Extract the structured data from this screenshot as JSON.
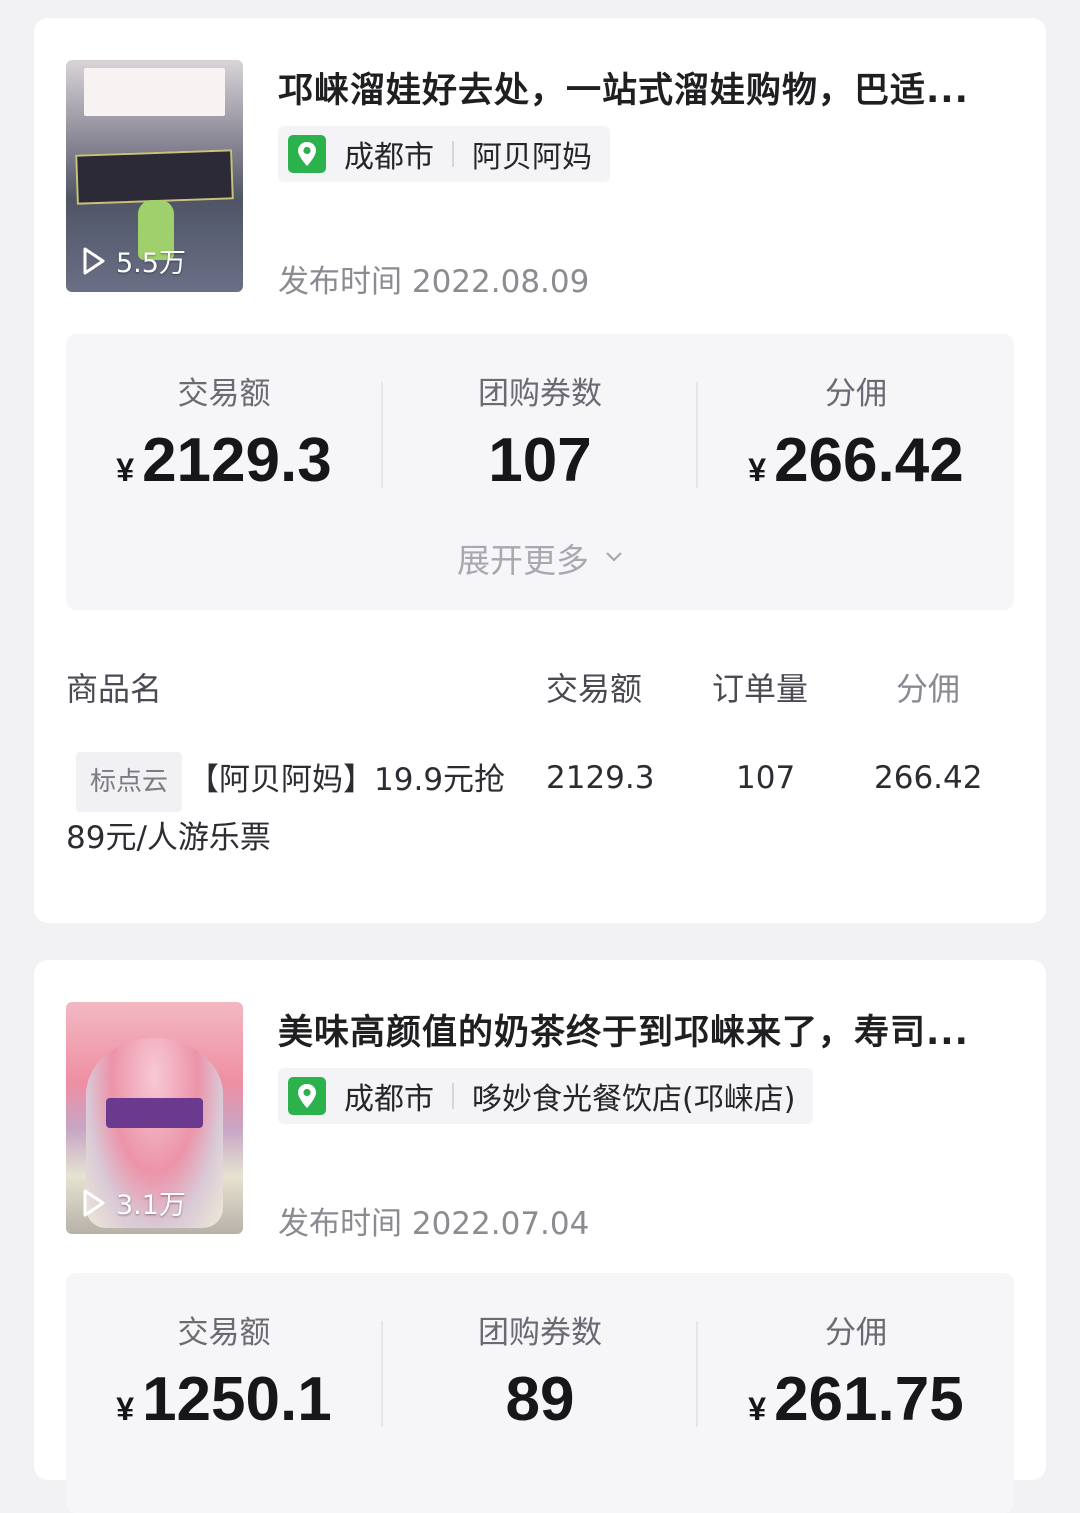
{
  "cards": [
    {
      "title": "邛崃溜娃好去处，一站式溜娃购物，巴适...",
      "views": "5.5万",
      "location": {
        "city": "成都市",
        "store": "阿贝阿妈"
      },
      "publish_label": "发布时间",
      "publish_date": "2022.08.09",
      "stats": [
        {
          "label": "交易额",
          "currency": "¥",
          "value": "2129.3"
        },
        {
          "label": "团购券数",
          "currency": "",
          "value": "107"
        },
        {
          "label": "分佣",
          "currency": "¥",
          "value": "266.42"
        }
      ],
      "expand_label": "展开更多",
      "table": {
        "headers": [
          "商品名",
          "交易额",
          "订单量",
          "分佣"
        ],
        "rows": [
          {
            "tag": "标点云",
            "name": "【阿贝阿妈】19.9元抢89元/人游乐票",
            "amount": "2129.3",
            "orders": "107",
            "commission": "266.42"
          }
        ]
      }
    },
    {
      "title": "美味高颜值的奶茶终于到邛崃来了，寿司...",
      "views": "3.1万",
      "location": {
        "city": "成都市",
        "store": "哆妙食光餐饮店(邛崃店)"
      },
      "publish_label": "发布时间",
      "publish_date": "2022.07.04",
      "stats": [
        {
          "label": "交易额",
          "currency": "¥",
          "value": "1250.1"
        },
        {
          "label": "团购券数",
          "currency": "",
          "value": "89"
        },
        {
          "label": "分佣",
          "currency": "¥",
          "value": "261.75"
        }
      ]
    }
  ],
  "colors": {
    "location_icon": "#2bb24c",
    "background": "#f2f2f4",
    "card": "#ffffff"
  }
}
